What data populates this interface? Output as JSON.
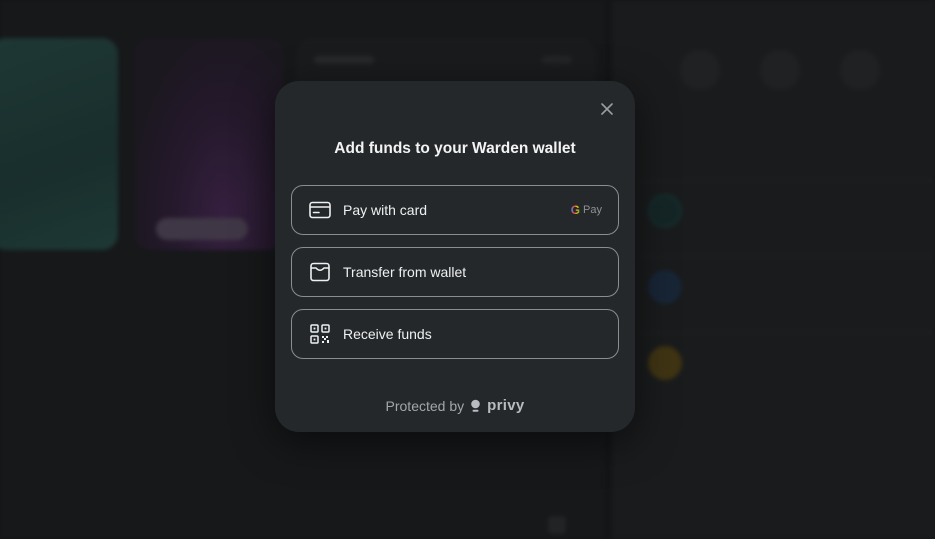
{
  "modal": {
    "title": "Add funds to your Warden wallet",
    "options": [
      {
        "label": "Pay with card",
        "icon": "credit-card-icon",
        "badge_g": "G",
        "badge_pay": "Pay"
      },
      {
        "label": "Transfer from wallet",
        "icon": "wallet-icon"
      },
      {
        "label": "Receive funds",
        "icon": "qr-code-icon"
      }
    ],
    "footer": {
      "protected_by": "Protected by",
      "brand": "privy"
    }
  },
  "colors": {
    "modal_bg": "#25282a",
    "option_border": "#8a8d91",
    "text": "#eef0f1",
    "teal_card": "#2e5a55",
    "purple_card": "#5a2f6a"
  }
}
